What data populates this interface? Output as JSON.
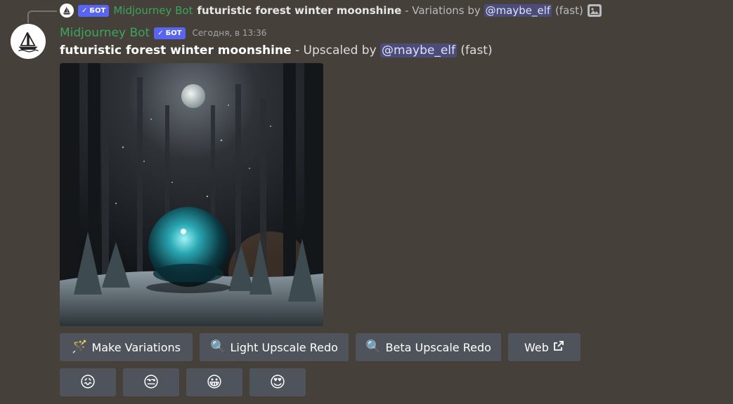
{
  "reply": {
    "author": "Midjourney Bot",
    "bot_tag": "БОТ",
    "prompt": "futuristic forest winter moonshine",
    "suffix": " - Variations by ",
    "mention": "@maybe_elf",
    "speed": " (fast)",
    "icon": "image-icon"
  },
  "message": {
    "author": "Midjourney Bot",
    "bot_tag": "БОТ",
    "timestamp": "Сегодня, в 13:36",
    "prompt": "futuristic forest winter moonshine",
    "suffix": " - Upscaled by ",
    "mention": "@maybe_elf",
    "speed": " (fast)"
  },
  "buttons": [
    {
      "label": "Make Variations",
      "icon": "magic-wand-icon",
      "glyph": "🪄"
    },
    {
      "label": "Light Upscale Redo",
      "icon": "magnifier-icon",
      "glyph": "🔍"
    },
    {
      "label": "Beta Upscale Redo",
      "icon": "magnifier-icon",
      "glyph": "🔍"
    },
    {
      "label": "Web",
      "icon": "external-link-icon",
      "glyph": "↗"
    }
  ],
  "reactions": [
    {
      "emoji": "😖",
      "icon": "confounded-face-icon"
    },
    {
      "emoji": "😒",
      "icon": "unamused-face-icon"
    },
    {
      "emoji": "😀",
      "icon": "grinning-face-icon"
    },
    {
      "emoji": "😍",
      "icon": "heart-eyes-icon"
    }
  ],
  "colors": {
    "background": "#46403a",
    "author": "#3ba55c",
    "bot_tag": "#5865f2",
    "button": "#4f545c"
  }
}
